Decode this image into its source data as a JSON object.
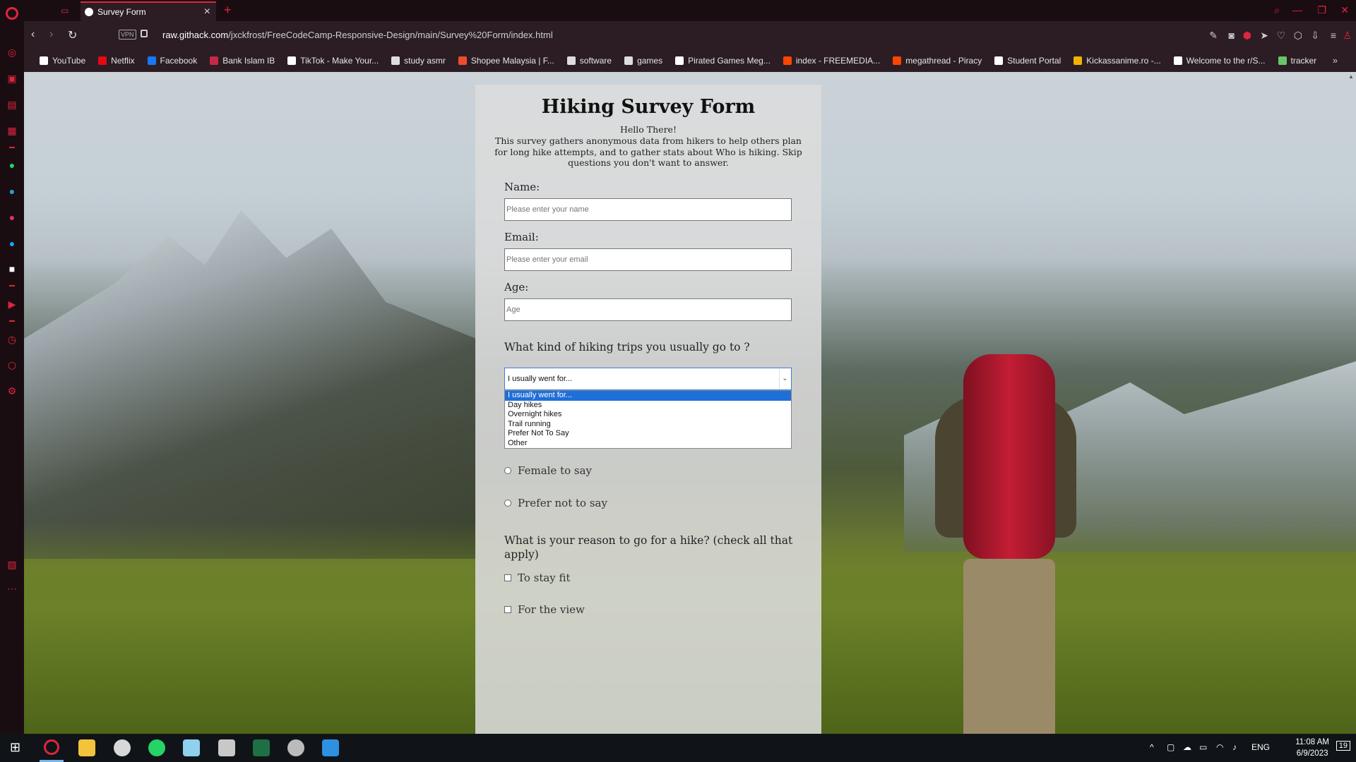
{
  "browser": {
    "tab": {
      "title": "Survey Form",
      "close": "×"
    },
    "new_tab": "+",
    "url_host": "raw.githack.com",
    "url_path": "/jxckfrost/FreeCodeCamp-Responsive-Design/main/Survey%20Form/index.html",
    "vpn_label": "VPN",
    "bookmarks": [
      {
        "label": "YouTube",
        "color": "#ffffff"
      },
      {
        "label": "Netflix",
        "color": "#e50914"
      },
      {
        "label": "Facebook",
        "color": "#1877f2"
      },
      {
        "label": "Bank Islam IB",
        "color": "#c22a48"
      },
      {
        "label": "TikTok - Make Your...",
        "color": "#ffffff"
      },
      {
        "label": "study asmr",
        "color": "#dddddd"
      },
      {
        "label": "Shopee Malaysia | F...",
        "color": "#ee4d2d"
      },
      {
        "label": "software",
        "color": "#dddddd"
      },
      {
        "label": "games",
        "color": "#dddddd"
      },
      {
        "label": "Pirated Games Meg...",
        "color": "#ffffff"
      },
      {
        "label": "index - FREEMEDIA...",
        "color": "#ff4500"
      },
      {
        "label": "megathread - Piracy",
        "color": "#ff4500"
      },
      {
        "label": "Student Portal",
        "color": "#ffffff"
      },
      {
        "label": "Kickassanime.ro -...",
        "color": "#f0b400"
      },
      {
        "label": "Welcome to the r/S...",
        "color": "#ffffff"
      },
      {
        "label": "tracker",
        "color": "#6ac46a"
      }
    ],
    "bookmarks_more": "»"
  },
  "form": {
    "title": "Hiking Survey Form",
    "greeting": "Hello There!",
    "description": "This survey gathers anonymous data from hikers to help others plan for long hike attempts, and to gather stats about Who is hiking. Skip questions you don't want to answer.",
    "name_label": "Name:",
    "name_placeholder": "Please enter your name",
    "email_label": "Email:",
    "email_placeholder": "Please enter your email",
    "age_label": "Age:",
    "age_placeholder": "Age",
    "trip_question": "What kind of hiking trips you usually go to ?",
    "trip_selected": "I usually went for...",
    "trip_options": [
      "I usually went for...",
      "Day hikes",
      "Overnight hikes",
      "Trail running",
      "Prefer Not To Say",
      "Other"
    ],
    "radio_female": "Female to say",
    "radio_prefer_not": "Prefer not to say",
    "reason_question": "What is your reason to go for a hike? (check all that apply)",
    "check_fit": "To stay fit",
    "check_view": "For the view"
  },
  "taskbar": {
    "lang": "ENG",
    "time": "11:08 AM",
    "date": "6/9/2023",
    "notifications": "19"
  },
  "colors": {
    "opera_red": "#e0253d",
    "select_highlight": "#1e6fd9"
  }
}
